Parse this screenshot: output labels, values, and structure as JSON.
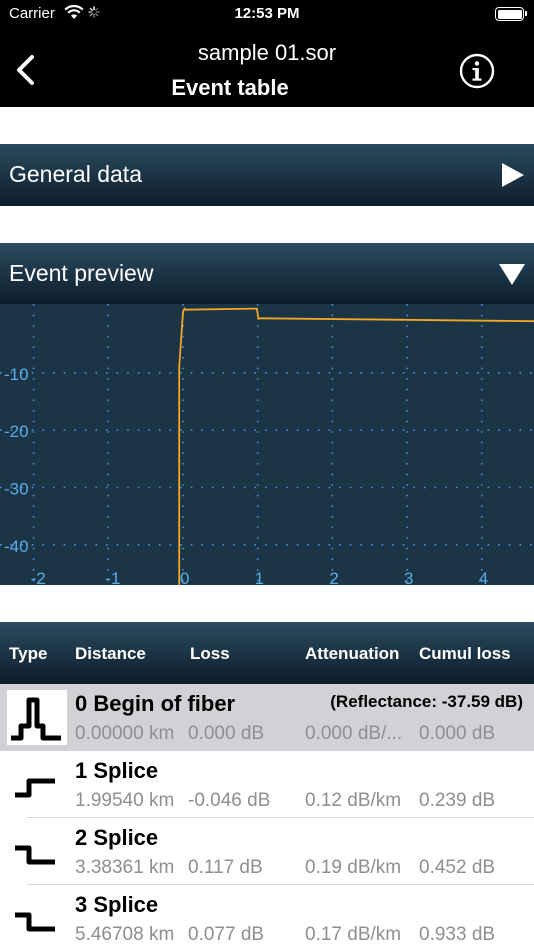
{
  "status": {
    "carrier": "Carrier",
    "time": "12:53 PM"
  },
  "nav": {
    "file_name": "sample 01.sor",
    "title": "Event table",
    "back_icon": "chevron-left-icon",
    "info_icon": "info-circle-icon"
  },
  "sections": {
    "general": {
      "label": "General data",
      "state": "collapsed"
    },
    "preview": {
      "label": "Event preview",
      "state": "expanded"
    }
  },
  "chart_data": {
    "type": "line",
    "x_ticks": [
      "-2",
      "-1",
      "0",
      "1",
      "2",
      "3",
      "4"
    ],
    "y_ticks": [
      "-10",
      "-20",
      "-30",
      "-40"
    ],
    "xlim": [
      -2.45,
      4.7
    ],
    "ylim": [
      -47,
      2
    ],
    "grid": true,
    "colors": {
      "background": "#1b3446",
      "trace": "#f5a623",
      "axis": "#5aaee8",
      "grid": "#4a90d9"
    },
    "series": [
      {
        "x": [
          -0.05,
          -0.05,
          0.0,
          0.02,
          0.04,
          0.97,
          0.99,
          1.01,
          1.04,
          4.7
        ],
        "y": [
          -47,
          -9,
          0.6,
          1.2,
          1.0,
          1.2,
          1.2,
          -0.6,
          -0.5,
          -1.0
        ]
      }
    ]
  },
  "table": {
    "headers": [
      "Type",
      "Distance",
      "Loss",
      "Attenuation",
      "Cumul loss"
    ],
    "rows": [
      {
        "icon": "reflective-event-icon",
        "name": "0 Begin of fiber",
        "reflectance": "(Reflectance: -37.59 dB)",
        "distance": "0.00000 km",
        "loss": "0.000 dB",
        "attenuation": "0.000 dB/...",
        "cumul": "0.000 dB",
        "selected": true
      },
      {
        "icon": "splice-gain-icon",
        "name": "1 Splice",
        "reflectance": "",
        "distance": "1.99540 km",
        "loss": "-0.046 dB",
        "attenuation": "0.12 dB/km",
        "cumul": "0.239 dB",
        "selected": false
      },
      {
        "icon": "splice-loss-icon",
        "name": "2 Splice",
        "reflectance": "",
        "distance": "3.38361 km",
        "loss": "0.117 dB",
        "attenuation": "0.19 dB/km",
        "cumul": "0.452 dB",
        "selected": false
      },
      {
        "icon": "splice-loss-icon",
        "name": "3 Splice",
        "reflectance": "",
        "distance": "5.46708 km",
        "loss": "0.077 dB",
        "attenuation": "0.17 dB/km",
        "cumul": "0.933 dB",
        "selected": false
      }
    ]
  }
}
